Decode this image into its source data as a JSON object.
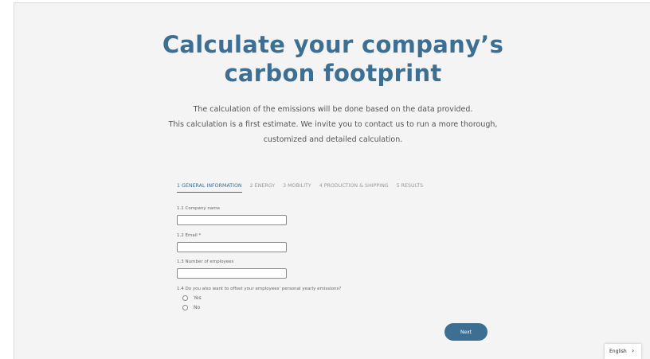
{
  "page": {
    "title_line1": "Calculate your company’s",
    "title_line2": "carbon footprint",
    "intro_line1": "The calculation of the emissions will be done based on the data provided.",
    "intro_line2": "This calculation is a first estimate. We invite you to contact us to run a more thorough,",
    "intro_line3": "customized and detailed calculation."
  },
  "steps": [
    {
      "label": "1 GENERAL INFORMATION",
      "active": true
    },
    {
      "label": "2 ENERGY",
      "active": false
    },
    {
      "label": "3 MOBILITY",
      "active": false
    },
    {
      "label": "4 PRODUCTION & SHIPPING",
      "active": false
    },
    {
      "label": "5 RESULTS",
      "active": false
    }
  ],
  "form": {
    "company_label": "1.1 Company name",
    "company_value": "",
    "email_label": "1.2 Email *",
    "email_value": "",
    "employees_label": "1.3 Number of employees",
    "employees_value": "",
    "offset_question": "1.4 Do you also want to offset your employees' personal yearly emissions?",
    "option_yes": "Yes",
    "option_no": "No",
    "next_label": "Next"
  },
  "language": {
    "selected": "English",
    "chevron_icon": "chevron-right-icon"
  },
  "colors": {
    "accent": "#3d6f93",
    "background": "#f4f4f4"
  }
}
